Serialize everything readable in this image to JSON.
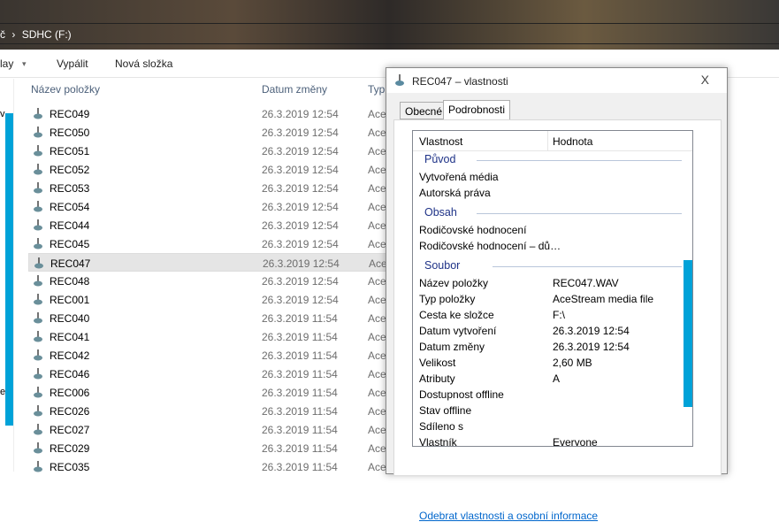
{
  "address": {
    "crumb_prev": "č",
    "separator": "›",
    "location": "SDHC (F:)"
  },
  "toolbar": {
    "play": "lay",
    "play_arrow": "▾",
    "burn": "Vypálit",
    "new_folder": "Nová složka"
  },
  "left_pane": {
    "c1": "v",
    "c2": "e"
  },
  "columns": {
    "name": "Název položky",
    "date": "Datum změny",
    "type": "Typ"
  },
  "files": [
    {
      "name": "REC049",
      "date": "26.3.2019 12:54",
      "type": "Ace"
    },
    {
      "name": "REC050",
      "date": "26.3.2019 12:54",
      "type": "Ace"
    },
    {
      "name": "REC051",
      "date": "26.3.2019 12:54",
      "type": "Ace"
    },
    {
      "name": "REC052",
      "date": "26.3.2019 12:54",
      "type": "Ace"
    },
    {
      "name": "REC053",
      "date": "26.3.2019 12:54",
      "type": "Ace"
    },
    {
      "name": "REC054",
      "date": "26.3.2019 12:54",
      "type": "Ace"
    },
    {
      "name": "REC044",
      "date": "26.3.2019 12:54",
      "type": "Ace"
    },
    {
      "name": "REC045",
      "date": "26.3.2019 12:54",
      "type": "Ace"
    },
    {
      "name": "REC047",
      "date": "26.3.2019 12:54",
      "type": "Ace",
      "selected": true
    },
    {
      "name": "REC048",
      "date": "26.3.2019 12:54",
      "type": "Ace"
    },
    {
      "name": "REC001",
      "date": "26.3.2019 12:54",
      "type": "Ace"
    },
    {
      "name": "REC040",
      "date": "26.3.2019 11:54",
      "type": "Ace"
    },
    {
      "name": "REC041",
      "date": "26.3.2019 11:54",
      "type": "Ace"
    },
    {
      "name": "REC042",
      "date": "26.3.2019 11:54",
      "type": "Ace"
    },
    {
      "name": "REC046",
      "date": "26.3.2019 11:54",
      "type": "Ace"
    },
    {
      "name": "REC006",
      "date": "26.3.2019 11:54",
      "type": "Ace"
    },
    {
      "name": "REC026",
      "date": "26.3.2019 11:54",
      "type": "Ace"
    },
    {
      "name": "REC027",
      "date": "26.3.2019 11:54",
      "type": "Ace"
    },
    {
      "name": "REC029",
      "date": "26.3.2019 11:54",
      "type": "Ace"
    },
    {
      "name": "REC035",
      "date": "26.3.2019 11:54",
      "type": "Ace"
    }
  ],
  "dialog": {
    "title": "REC047 – vlastnosti",
    "close": "X",
    "tabs": [
      "Obecné",
      "Podrobnosti"
    ],
    "list_header": {
      "property": "Vlastnost",
      "value": "Hodnota"
    },
    "groups": {
      "origin": "Původ",
      "content": "Obsah",
      "file": "Soubor"
    },
    "origin": [
      "Vytvořená média",
      "Autorská práva"
    ],
    "content": [
      "Rodičovské hodnocení",
      "Rodičovské hodnocení – dů…"
    ],
    "file": [
      {
        "p": "Název položky",
        "v": "REC047.WAV"
      },
      {
        "p": "Typ položky",
        "v": "AceStream media file"
      },
      {
        "p": "Cesta ke složce",
        "v": "F:\\"
      },
      {
        "p": "Datum vytvoření",
        "v": "26.3.2019 12:54"
      },
      {
        "p": "Datum změny",
        "v": "26.3.2019 12:54"
      },
      {
        "p": "Velikost",
        "v": "2,60 MB"
      },
      {
        "p": "Atributy",
        "v": "A"
      },
      {
        "p": "Dostupnost offline",
        "v": ""
      },
      {
        "p": "Stav offline",
        "v": ""
      },
      {
        "p": "Sdíleno s",
        "v": ""
      },
      {
        "p": "Vlastník",
        "v": "Everyone"
      }
    ],
    "remove_link": "Odebrat vlastnosti a osobní informace"
  }
}
